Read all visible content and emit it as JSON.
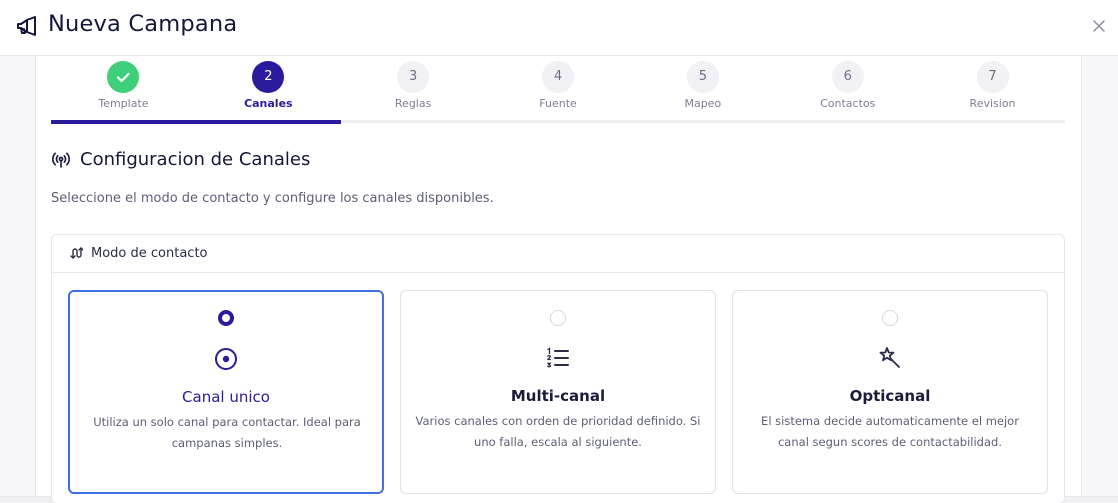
{
  "header": {
    "title": "Nueva Campana",
    "title_icon": "megaphone-icon",
    "close_icon": "close-icon"
  },
  "stepper": {
    "current_step": 2,
    "steps": [
      {
        "number": "1",
        "label": "Template",
        "state": "done"
      },
      {
        "number": "2",
        "label": "Canales",
        "state": "active"
      },
      {
        "number": "3",
        "label": "Reglas",
        "state": "pending"
      },
      {
        "number": "4",
        "label": "Fuente",
        "state": "pending"
      },
      {
        "number": "5",
        "label": "Mapeo",
        "state": "pending"
      },
      {
        "number": "6",
        "label": "Contactos",
        "state": "pending"
      },
      {
        "number": "7",
        "label": "Revision",
        "state": "pending"
      }
    ]
  },
  "section": {
    "icon": "antenna-icon",
    "title": "Configuracion de Canales",
    "description": "Seleccione el modo de contacto y configure los canales disponibles."
  },
  "contact_mode": {
    "icon": "route-icon",
    "label": "Modo de contacto",
    "options": [
      {
        "title": "Canal unico",
        "description": "Utiliza un solo canal para contactar. Ideal para campanas simples.",
        "icon": "target-icon",
        "selected": true
      },
      {
        "title": "Multi-canal",
        "description": "Varios canales con orden de prioridad definido. Si uno falla, escala al siguiente.",
        "icon": "numbered-list-icon",
        "selected": false
      },
      {
        "title": "Opticanal",
        "description": "El sistema decide automaticamente el mejor canal segun scores de contactabilidad.",
        "icon": "magic-wand-icon",
        "selected": false
      }
    ]
  },
  "colors": {
    "primary": "#2a1a9c",
    "success": "#3ecf7b",
    "selected_border": "#3f6fe0"
  }
}
